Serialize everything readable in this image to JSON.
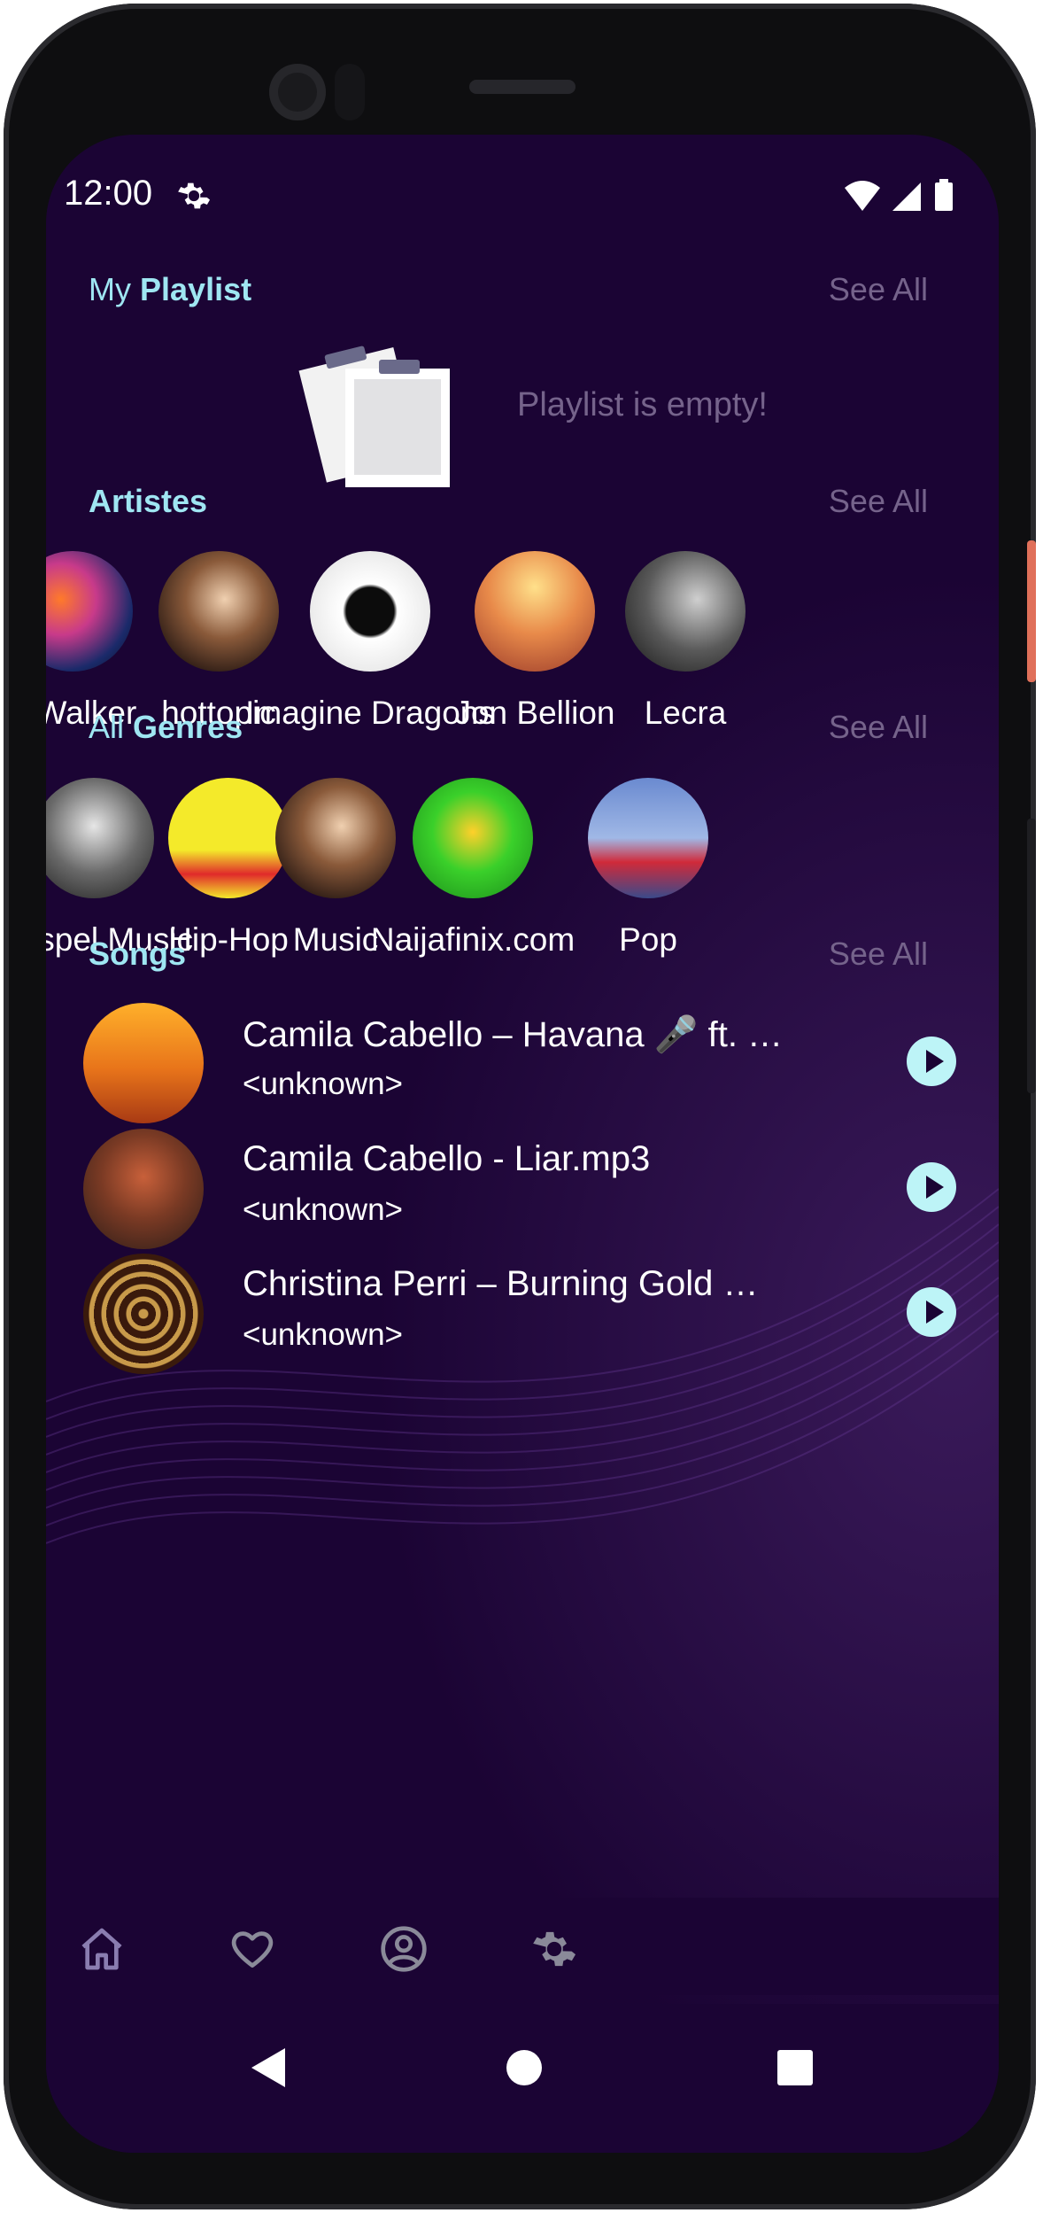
{
  "status_bar": {
    "time": "12:00"
  },
  "playlist": {
    "title_prefix": "My",
    "title_bold": "Playlist",
    "see_all": "See All",
    "empty_text": "Playlist is empty!"
  },
  "artists": {
    "title": "Artistes",
    "see_all": "See All",
    "items": [
      {
        "label": "n Walker"
      },
      {
        "label": "hottopic"
      },
      {
        "label": "Imagine Dragons"
      },
      {
        "label": "Jon Bellion"
      },
      {
        "label": "Lecra"
      }
    ]
  },
  "genres": {
    "title_prefix": "All",
    "title_bold": "Genres",
    "see_all": "See All",
    "items": [
      {
        "label": "Gospel Music"
      },
      {
        "label": "Hip-Hop"
      },
      {
        "label": "Music"
      },
      {
        "label": "Naijafinix.com"
      },
      {
        "label": "Pop"
      }
    ]
  },
  "songs": {
    "title": "Songs",
    "see_all": "See All",
    "items": [
      {
        "title": "Camila Cabello – Havana 🎤 ft. …",
        "artist": "<unknown>"
      },
      {
        "title": "Camila Cabello - Liar.mp3",
        "artist": "<unknown>"
      },
      {
        "title": "Christina Perri – Burning Gold …",
        "artist": "<unknown>"
      }
    ]
  },
  "bottom_nav": [
    "home-icon",
    "heart-icon",
    "profile-icon",
    "settings-icon"
  ],
  "colors": {
    "background": "#1b0434",
    "accent": "#9fe6f2",
    "muted": "#75638b",
    "play": "#bdf4f7"
  }
}
